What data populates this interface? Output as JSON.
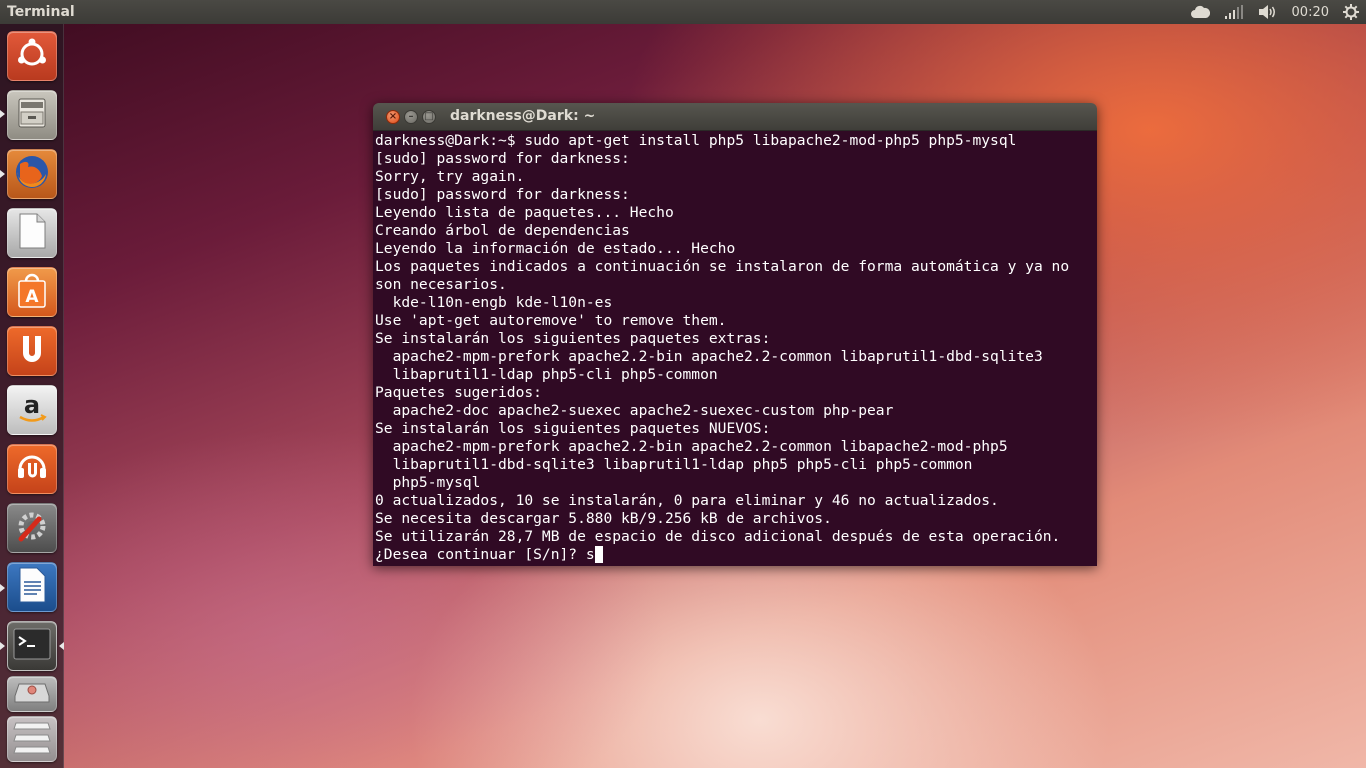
{
  "top_panel": {
    "app_title": "Terminal",
    "clock": "00:20",
    "indicators": [
      "cloud-icon",
      "network-signal-icon",
      "volume-icon",
      "session-gear-icon"
    ]
  },
  "launcher": {
    "items": [
      {
        "name": "dash-home",
        "icon": "ubuntu-logo-icon"
      },
      {
        "name": "files",
        "icon": "file-cabinet-icon"
      },
      {
        "name": "firefox",
        "icon": "firefox-icon"
      },
      {
        "name": "libreoffice",
        "icon": "libreoffice-doc-icon"
      },
      {
        "name": "software-center",
        "icon": "shopping-bag-icon"
      },
      {
        "name": "ubuntu-one",
        "icon": "ubuntu-one-icon"
      },
      {
        "name": "amazon",
        "icon": "amazon-icon"
      },
      {
        "name": "ubuntu-one-music",
        "icon": "ubuntu-one-music-icon"
      },
      {
        "name": "system-settings",
        "icon": "settings-wrench-icon"
      },
      {
        "name": "libreoffice-writer",
        "icon": "writer-document-icon"
      },
      {
        "name": "terminal",
        "icon": "terminal-icon"
      },
      {
        "name": "drive",
        "icon": "drive-icon"
      },
      {
        "name": "workspaces",
        "icon": "workspace-stack-icon"
      }
    ]
  },
  "window": {
    "title": "darkness@Dark: ~",
    "lines": [
      "darkness@Dark:~$ sudo apt-get install php5 libapache2-mod-php5 php5-mysql",
      "[sudo] password for darkness: ",
      "Sorry, try again.",
      "[sudo] password for darkness: ",
      "Leyendo lista de paquetes... Hecho",
      "Creando árbol de dependencias",
      "Leyendo la información de estado... Hecho",
      "Los paquetes indicados a continuación se instalaron de forma automática y ya no",
      "son necesarios.",
      "  kde-l10n-engb kde-l10n-es",
      "Use 'apt-get autoremove' to remove them.",
      "Se instalarán los siguientes paquetes extras:",
      "  apache2-mpm-prefork apache2.2-bin apache2.2-common libaprutil1-dbd-sqlite3",
      "  libaprutil1-ldap php5-cli php5-common",
      "Paquetes sugeridos:",
      "  apache2-doc apache2-suexec apache2-suexec-custom php-pear",
      "Se instalarán los siguientes paquetes NUEVOS:",
      "  apache2-mpm-prefork apache2.2-bin apache2.2-common libapache2-mod-php5",
      "  libaprutil1-dbd-sqlite3 libaprutil1-ldap php5 php5-cli php5-common",
      "  php5-mysql",
      "0 actualizados, 10 se instalarán, 0 para eliminar y 46 no actualizados.",
      "Se necesita descargar 5.880 kB/9.256 kB de archivos.",
      "Se utilizarán 28,7 MB de espacio de disco adicional después de esta operación."
    ],
    "prompt_line": "¿Desea continuar [S/n]? s"
  }
}
